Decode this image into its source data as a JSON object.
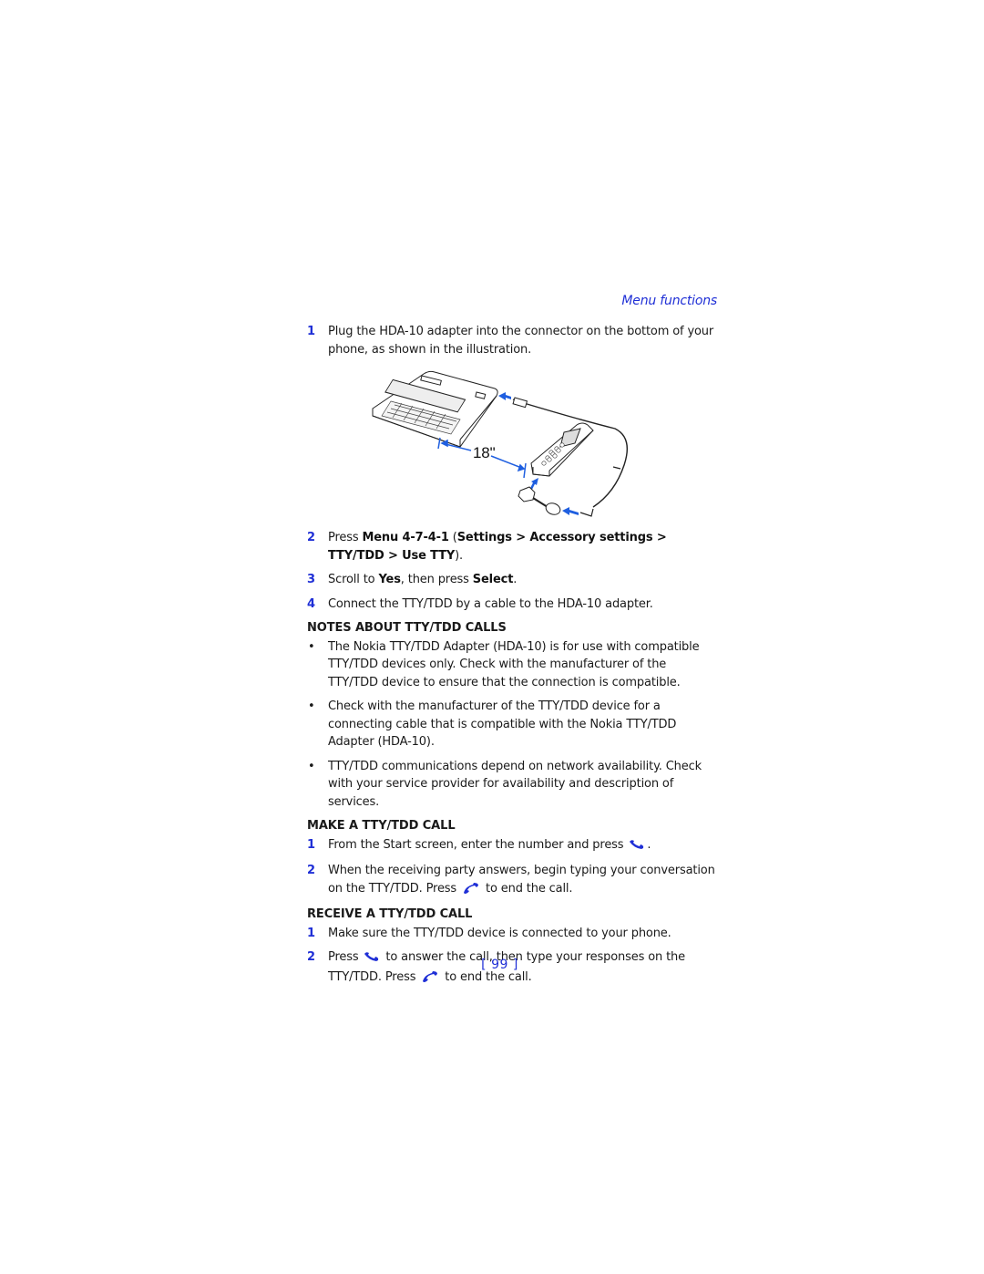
{
  "header": {
    "section_title": "Menu functions"
  },
  "steps_intro": [
    {
      "num": "1",
      "text": "Plug the HDA-10 adapter into the connector on the bottom of your phone, as shown in the illustration."
    }
  ],
  "illustration": {
    "label": "18\"",
    "accent_color": "#1f5fe0"
  },
  "steps_main": [
    {
      "num": "2",
      "pre": "Press ",
      "kw1": "Menu 4-7-4-1",
      "mid": " (",
      "kw2": "Settings > Accessory settings > TTY/TDD > Use TTY",
      "post": ")."
    },
    {
      "num": "3",
      "pre": "Scroll to ",
      "kw1": "Yes",
      "mid": ", then press ",
      "kw2": "Select",
      "post": "."
    },
    {
      "num": "4",
      "text": "Connect the TTY/TDD by a cable to the HDA-10 adapter."
    }
  ],
  "notes": {
    "heading": "NOTES ABOUT TTY/TDD CALLS",
    "bullets": [
      "The Nokia TTY/TDD Adapter (HDA-10) is for use with compatible TTY/TDD devices only. Check with the manufacturer of the TTY/TDD device to ensure that the connection is compatible.",
      "Check with the manufacturer of the TTY/TDD device for a connecting cable that is compatible with the Nokia TTY/TDD Adapter (HDA-10).",
      "TTY/TDD communications depend on network availability. Check with your service provider for availability and description of services."
    ],
    "bullet_char": "•"
  },
  "make_call": {
    "heading": "MAKE A TTY/TDD CALL",
    "step1": {
      "num": "1",
      "pre": "From the Start screen, enter the number and press ",
      "icon": "call-key-icon",
      "post": "."
    },
    "step2": {
      "num": "2",
      "pre": "When the receiving party answers, begin typing your conversation on the TTY/TDD. Press ",
      "icon": "end-key-icon",
      "post": " to end the call."
    }
  },
  "receive_call": {
    "heading": "RECEIVE A TTY/TDD CALL",
    "step1": {
      "num": "1",
      "text": "Make sure the TTY/TDD device is connected to your phone."
    },
    "step2": {
      "num": "2",
      "pre": "Press ",
      "icon1": "call-key-icon",
      "mid": " to answer the call, then type your responses on the TTY/TDD. Press ",
      "icon2": "end-key-icon",
      "post": " to end the call."
    }
  },
  "footer": {
    "page_number": "[ 99 ]"
  },
  "colors": {
    "accent": "#1f2fd6",
    "text": "#1a1a1a"
  }
}
